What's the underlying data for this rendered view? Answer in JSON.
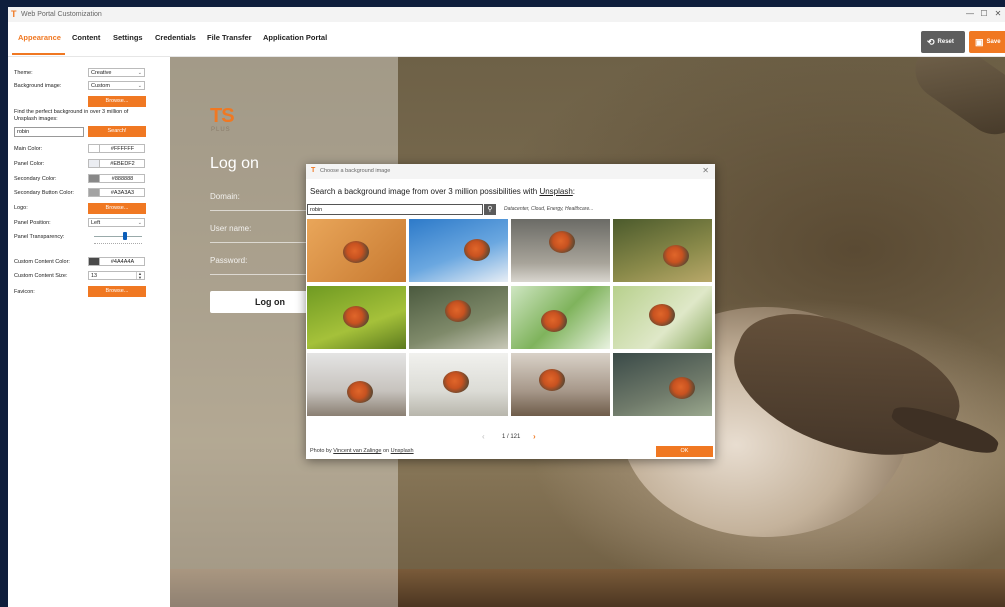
{
  "window": {
    "title": "Web Portal Customization",
    "controls": [
      "—",
      "☐",
      "✕"
    ]
  },
  "menu": {
    "tabs": [
      "Appearance",
      "Content",
      "Settings",
      "Credentials",
      "File Transfer",
      "Application Portal"
    ],
    "active_tab": "Appearance",
    "reset_label": "Reset",
    "save_label": "Save"
  },
  "settings": {
    "theme_label": "Theme:",
    "theme_value": "Creative",
    "background_label": "Background image:",
    "background_value": "Custom",
    "browse_label": "Browse...",
    "find_text": "Find the perfect background in over 3 million of Unsplash images:",
    "search_value": "robin",
    "search_label": "Search!",
    "main_color_label": "Main Color:",
    "main_color_value": "#FFFFFF",
    "panel_color_label": "Panel Color:",
    "panel_color_value": "#EBEDF2",
    "secondary_color_label": "Secondary Color:",
    "secondary_color_value": "#888888",
    "secondary_button_color_label": "Secondary Button Color:",
    "secondary_button_color_value": "#A3A3A3",
    "logo_label": "Logo:",
    "logo_browse_label": "Browse...",
    "panel_position_label": "Panel Position:",
    "panel_position_value": "Left",
    "panel_transparency_label": "Panel Transparency:",
    "panel_transparency_value": 0.65,
    "custom_content_color_label": "Custom Content Color:",
    "custom_content_color_value": "#4A4A4A",
    "custom_content_size_label": "Custom Content Size:",
    "custom_content_size_value": "13",
    "favicon_label": "Favicon:",
    "favicon_browse_label": "Browse..."
  },
  "login_preview": {
    "logo_main": "TS",
    "logo_sub": "PLUS",
    "title": "Log on",
    "domain_placeholder": "Domain:",
    "username_placeholder": "User name:",
    "password_placeholder": "Password:",
    "button_label": "Log on"
  },
  "dialog": {
    "title": "Choose a background image",
    "close": "✕",
    "heading_prefix": "Search a background image from over 3 million possibilities with ",
    "heading_link": "Unsplash",
    "heading_suffix": ":",
    "search_value": "robin",
    "hint": "Datacenter, Cloud, Energy, Healthcare...",
    "page_current": "1",
    "page_total": "121",
    "page_text": "1 / 121",
    "credit_prefix": "Photo by ",
    "credit_author": "Vincent van Zalinge",
    "credit_middle": " on ",
    "credit_site": "Unsplash",
    "ok_label": "OK"
  },
  "colors": {
    "accent": "#f07822",
    "window_bg": "#0f1e3c"
  }
}
